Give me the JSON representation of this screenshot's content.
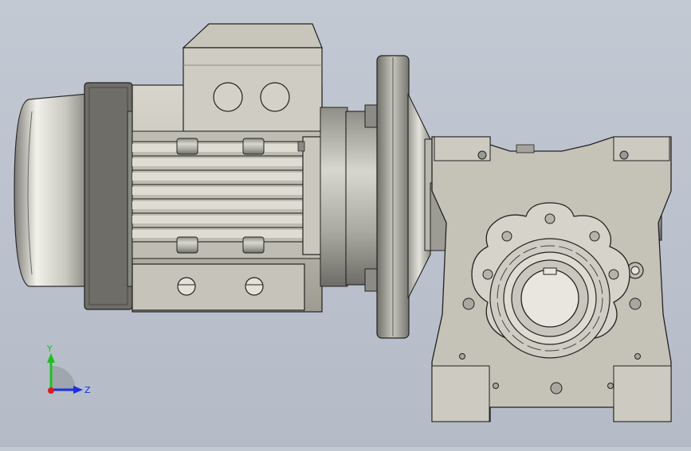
{
  "viewport": {
    "background_top": "#c3c9d3",
    "background_bottom": "#b4bbc7"
  },
  "triad": {
    "y_label": "Y",
    "z_label": "Z",
    "y_color": "#18c418",
    "z_color": "#1a2ee6",
    "x_color": "#e01a1a"
  }
}
